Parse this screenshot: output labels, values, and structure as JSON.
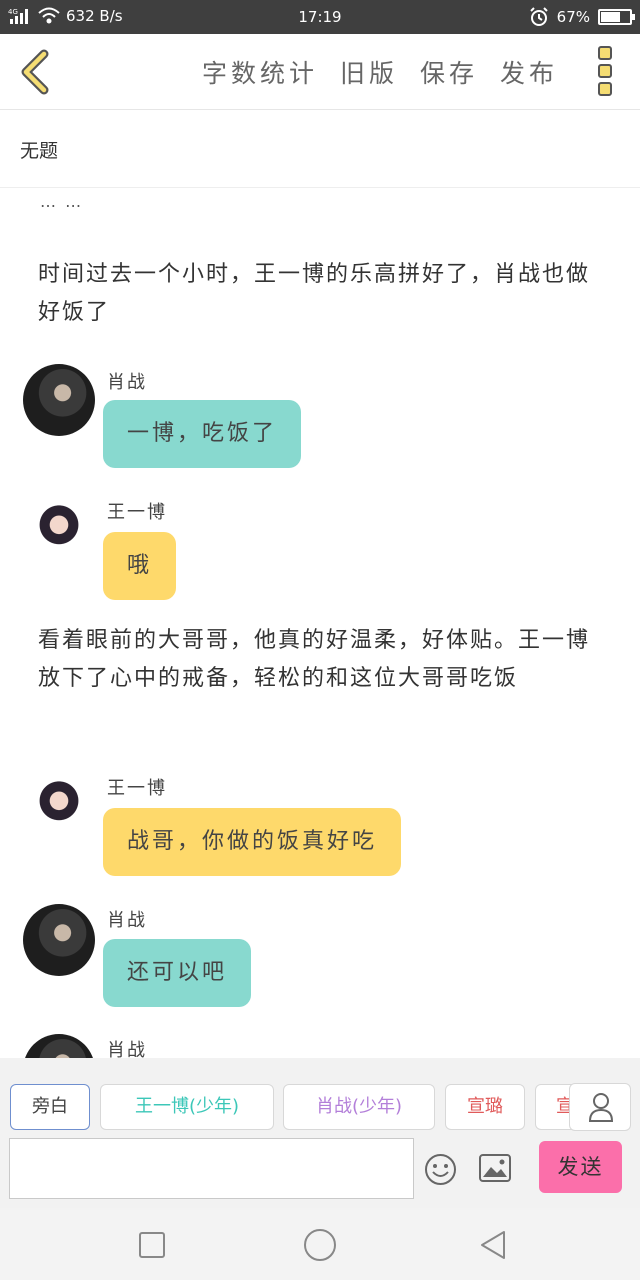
{
  "status_bar": {
    "network": "4G",
    "speed": "632 B/s",
    "time": "17:19",
    "battery": "67%",
    "battery_level": 0.67
  },
  "header": {
    "actions": [
      "字数统计",
      "旧版",
      "保存",
      "发布"
    ]
  },
  "document": {
    "title": "无题"
  },
  "content": {
    "ellipsis": "… …",
    "narration_1": "时间过去一个小时，王一博的乐高拼好了，肖战也做好饭了",
    "messages": [
      {
        "speaker": "肖战",
        "text": "一博，吃饭了",
        "color": "#88d9cf"
      },
      {
        "speaker": "王一博",
        "text": "哦",
        "color": "#fed96b"
      }
    ],
    "narration_2": "看着眼前的大哥哥，他真的好温柔，好体贴。王一博放下了心中的戒备，轻松的和这位大哥哥吃饭",
    "messages_2": [
      {
        "speaker": "王一博",
        "text": "战哥，你做的饭真好吃",
        "color": "#fed96b"
      },
      {
        "speaker": "肖战",
        "text": "还可以吧",
        "color": "#88d9cf"
      },
      {
        "speaker": "肖战"
      }
    ]
  },
  "toolbar": {
    "roles": [
      {
        "label": "旁白",
        "color": "#444444"
      },
      {
        "label": "王一博(少年)",
        "color": "#3cc7b8"
      },
      {
        "label": "肖战(少年)",
        "color": "#b37fd9"
      },
      {
        "label": "宣璐",
        "color": "#e05a5a"
      },
      {
        "label": "宣",
        "color": "#e05a5a"
      }
    ],
    "input_value": "",
    "send_label": "发送",
    "icons": [
      "user-icon",
      "emoji-icon",
      "image-icon"
    ]
  },
  "navbar": {
    "icons": [
      "square-icon",
      "circle-icon",
      "triangle-back-icon"
    ]
  }
}
